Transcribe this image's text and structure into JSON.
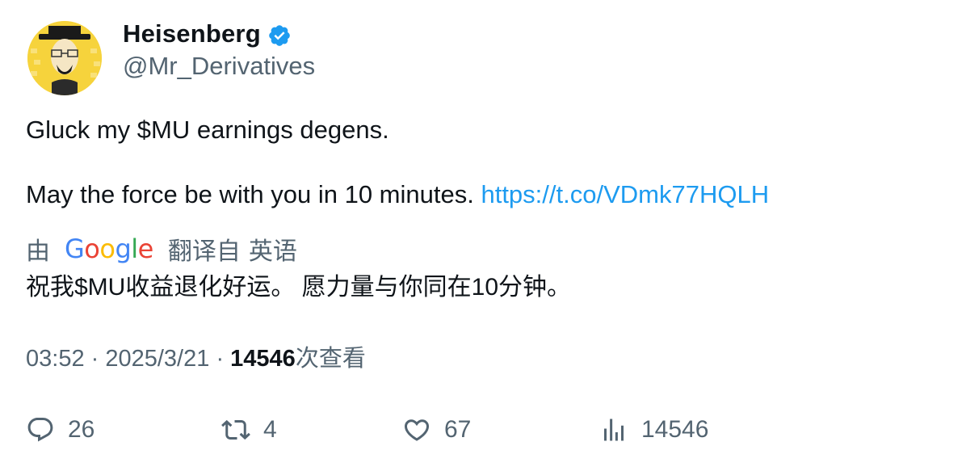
{
  "author": {
    "display_name": "Heisenberg",
    "handle": "@Mr_Derivatives",
    "verified": true,
    "verified_color": "#1d9bf0",
    "avatar_icon": "heisenberg-avatar"
  },
  "tweet": {
    "line1": "Gluck my $MU earnings degens.",
    "line2_text": "May the force be with you in 10 minutes.",
    "link": "https://t.co/VDmk77HQLH"
  },
  "translation": {
    "prefix": "由",
    "provider": "Google",
    "suffix": "翻译自",
    "source_language": "英语",
    "text": "祝我$MU收益退化好运。 愿力量与你同在10分钟。"
  },
  "meta": {
    "time": "03:52",
    "separator": "·",
    "date": "2025/3/21",
    "views_count": "14546",
    "views_label": "次查看"
  },
  "actions": {
    "replies": "26",
    "retweets": "4",
    "likes": "67",
    "views": "14546"
  },
  "colors": {
    "text": "#0f1419",
    "secondary": "#536471",
    "link": "#1d9bf0"
  }
}
